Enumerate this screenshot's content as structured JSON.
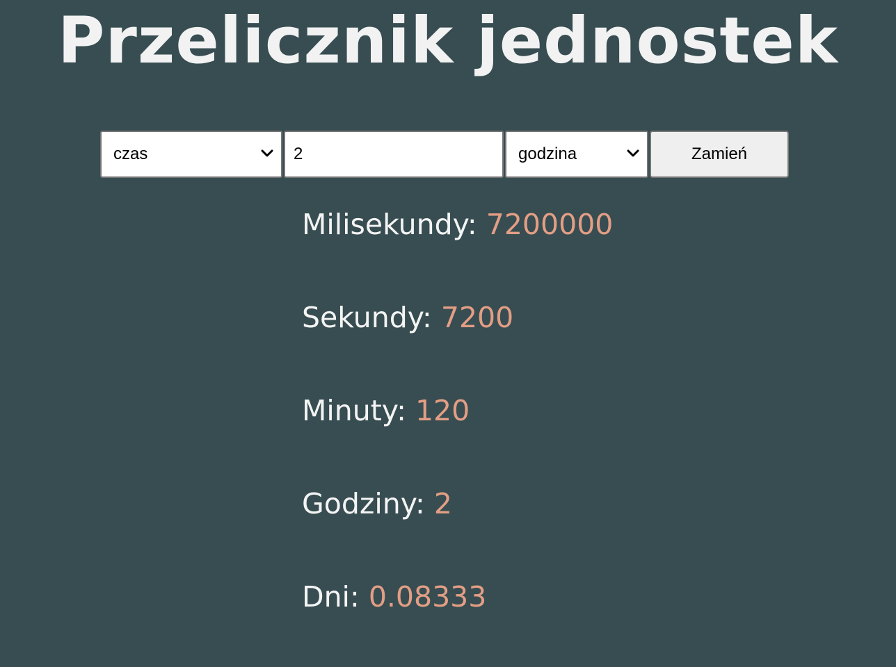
{
  "page": {
    "title": "Przelicznik jednostek"
  },
  "controls": {
    "category_select": "czas",
    "value_input": "2",
    "unit_select": "godzina",
    "convert_label": "Zamień"
  },
  "results": [
    {
      "label": "Milisekundy:",
      "value": "7200000"
    },
    {
      "label": "Sekundy:",
      "value": "7200"
    },
    {
      "label": "Minuty:",
      "value": "120"
    },
    {
      "label": "Godziny:",
      "value": "2"
    },
    {
      "label": "Dni:",
      "value": "0.08333"
    }
  ],
  "colors": {
    "background": "#374d51",
    "title": "#f2f2f2",
    "label": "#f4f4f4",
    "value": "#e39e85"
  },
  "icons": {
    "select_arrow": "chevron-down-icon"
  }
}
